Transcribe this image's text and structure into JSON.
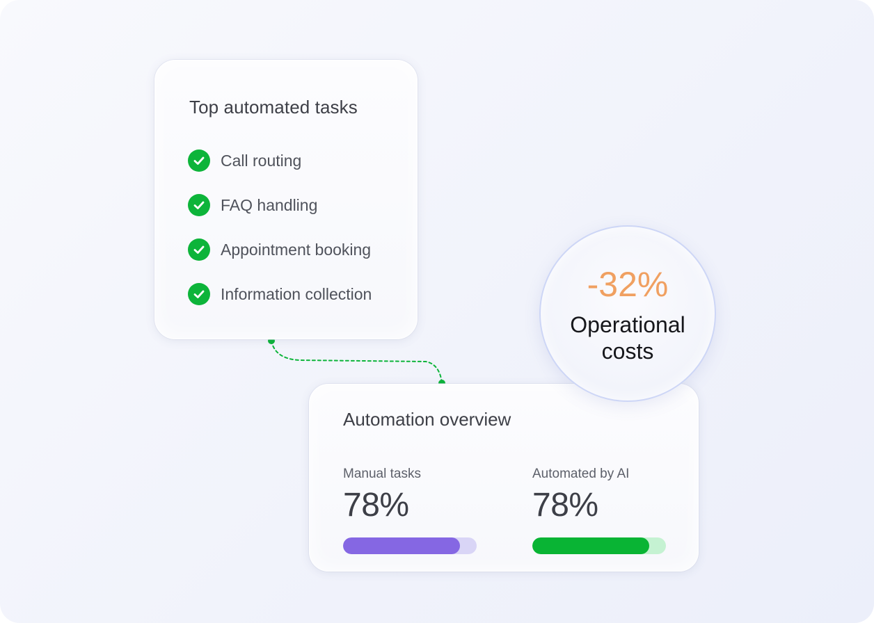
{
  "tasks": {
    "title": "Top automated tasks",
    "items": [
      {
        "label": "Call routing",
        "icon": "check-circle-icon"
      },
      {
        "label": "FAQ handling",
        "icon": "check-circle-icon"
      },
      {
        "label": "Appointment booking",
        "icon": "check-circle-icon"
      },
      {
        "label": "Information collection",
        "icon": "check-circle-icon"
      }
    ]
  },
  "overview": {
    "title": "Automation overview",
    "manual": {
      "label": "Manual tasks",
      "value": "78%",
      "fill": 0.875,
      "bar_color": "#8567e3",
      "track_color": "#d9d5f6"
    },
    "automated": {
      "label": "Automated by AI",
      "value": "78%",
      "fill": 0.875,
      "bar_color": "#09b434",
      "track_color": "#c5f2d2"
    }
  },
  "cost": {
    "value": "-32%",
    "label_line1": "Operational",
    "label_line2": "costs"
  },
  "colors": {
    "check": "#0db43a",
    "connector": "#0db43a",
    "cost_value": "#f0a061"
  }
}
